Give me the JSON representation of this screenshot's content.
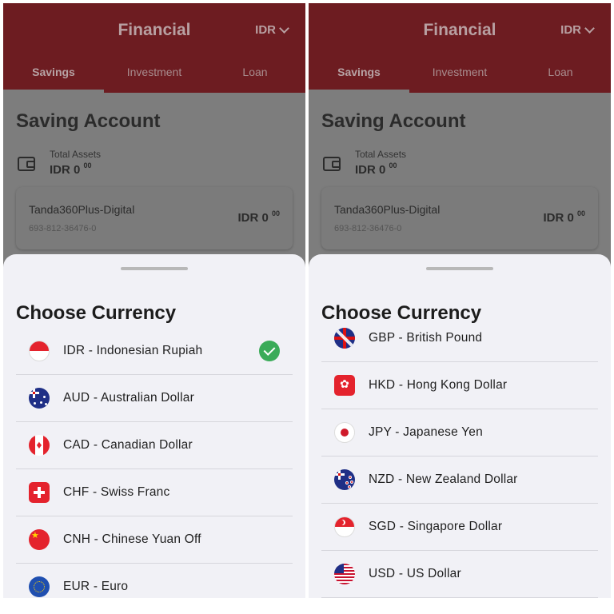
{
  "screens": [
    {
      "header": {
        "title": "Financial",
        "currency": "IDR",
        "tabs": [
          "Savings",
          "Investment",
          "Loan"
        ],
        "active_tab": "Savings"
      },
      "saving": {
        "title": "Saving Account",
        "total_label": "Total Assets",
        "total_amount": "IDR 0",
        "total_cents": "00",
        "account": {
          "name": "Tanda360Plus-Digital",
          "number": "693-812-36476-0",
          "amount": "IDR 0",
          "cents": "00"
        }
      },
      "sheet": {
        "title": "Choose Currency",
        "currencies": [
          {
            "label": "IDR - Indonesian Rupiah",
            "flag": "idr-flag-icon",
            "selected": true
          },
          {
            "label": "AUD - Australian Dollar",
            "flag": "aud-flag-icon",
            "selected": false
          },
          {
            "label": "CAD - Canadian Dollar",
            "flag": "cad-flag-icon",
            "selected": false
          },
          {
            "label": "CHF - Swiss Franc",
            "flag": "chf-flag-icon",
            "selected": false
          },
          {
            "label": "CNH - Chinese Yuan Off",
            "flag": "cnh-flag-icon",
            "selected": false
          },
          {
            "label": "EUR - Euro",
            "flag": "eur-flag-icon",
            "selected": false
          }
        ]
      }
    },
    {
      "header": {
        "title": "Financial",
        "currency": "IDR",
        "tabs": [
          "Savings",
          "Investment",
          "Loan"
        ],
        "active_tab": "Savings"
      },
      "saving": {
        "title": "Saving Account",
        "total_label": "Total Assets",
        "total_amount": "IDR 0",
        "total_cents": "00",
        "account": {
          "name": "Tanda360Plus-Digital",
          "number": "693-812-36476-0",
          "amount": "IDR 0",
          "cents": "00"
        }
      },
      "sheet": {
        "title": "Choose Currency",
        "currencies": [
          {
            "label": "GBP - British Pound",
            "flag": "gbp-flag-icon",
            "selected": false
          },
          {
            "label": "HKD - Hong Kong Dollar",
            "flag": "hkd-flag-icon",
            "selected": false
          },
          {
            "label": "JPY - Japanese Yen",
            "flag": "jpy-flag-icon",
            "selected": false
          },
          {
            "label": "NZD - New Zealand Dollar",
            "flag": "nzd-flag-icon",
            "selected": false
          },
          {
            "label": "SGD - Singapore Dollar",
            "flag": "sgd-flag-icon",
            "selected": false
          },
          {
            "label": "USD - US Dollar",
            "flag": "usd-flag-icon",
            "selected": false
          }
        ]
      }
    }
  ],
  "colors": {
    "header_bg": "#6d1c21",
    "sheet_bg": "#f1f1f6",
    "check_green": "#3aab58",
    "overlay": "#7d7d7d"
  }
}
